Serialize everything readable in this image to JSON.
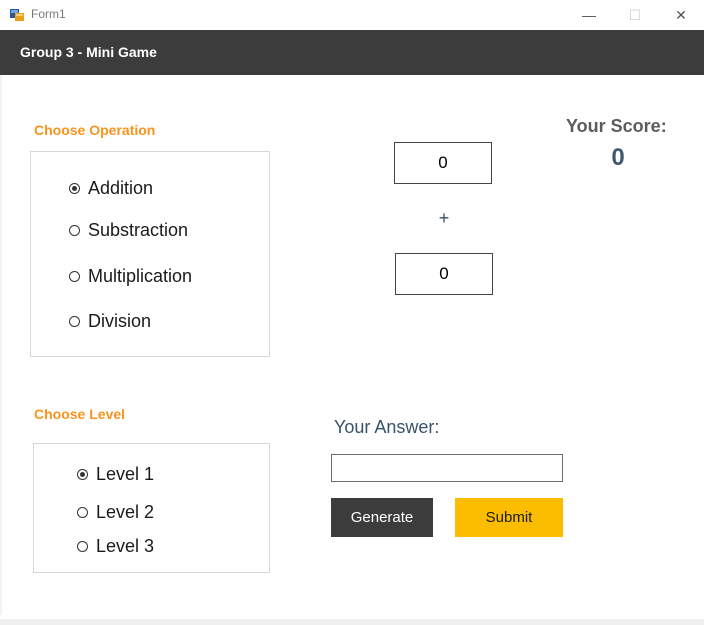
{
  "window": {
    "title": "Form1",
    "minimize_glyph": "—",
    "maximize_glyph": "☐",
    "close_glyph": "✕"
  },
  "banner": {
    "title": "Group 3 - Mini Game"
  },
  "operation": {
    "heading": "Choose Operation",
    "selected": "Addition",
    "options": [
      {
        "label": "Addition",
        "checked": true
      },
      {
        "label": "Substraction",
        "checked": false
      },
      {
        "label": "Multiplication",
        "checked": false
      },
      {
        "label": "Division",
        "checked": false
      }
    ]
  },
  "level": {
    "heading": "Choose Level",
    "selected": "Level 1",
    "options": [
      {
        "label": "Level 1",
        "checked": true
      },
      {
        "label": "Level 2",
        "checked": false
      },
      {
        "label": "Level 3",
        "checked": false
      }
    ]
  },
  "problem": {
    "first_number": "0",
    "operator": "+",
    "second_number": "0"
  },
  "score": {
    "label": "Your Score:",
    "value": "0"
  },
  "answer": {
    "label": "Your Answer:",
    "value": "",
    "placeholder": ""
  },
  "buttons": {
    "generate_label": "Generate",
    "submit_label": "Submit"
  },
  "colors": {
    "accent_orange": "#f7941d",
    "banner_dark": "#3c3c3c",
    "submit_yellow": "#fcbd00",
    "label_slate": "#37526b"
  }
}
